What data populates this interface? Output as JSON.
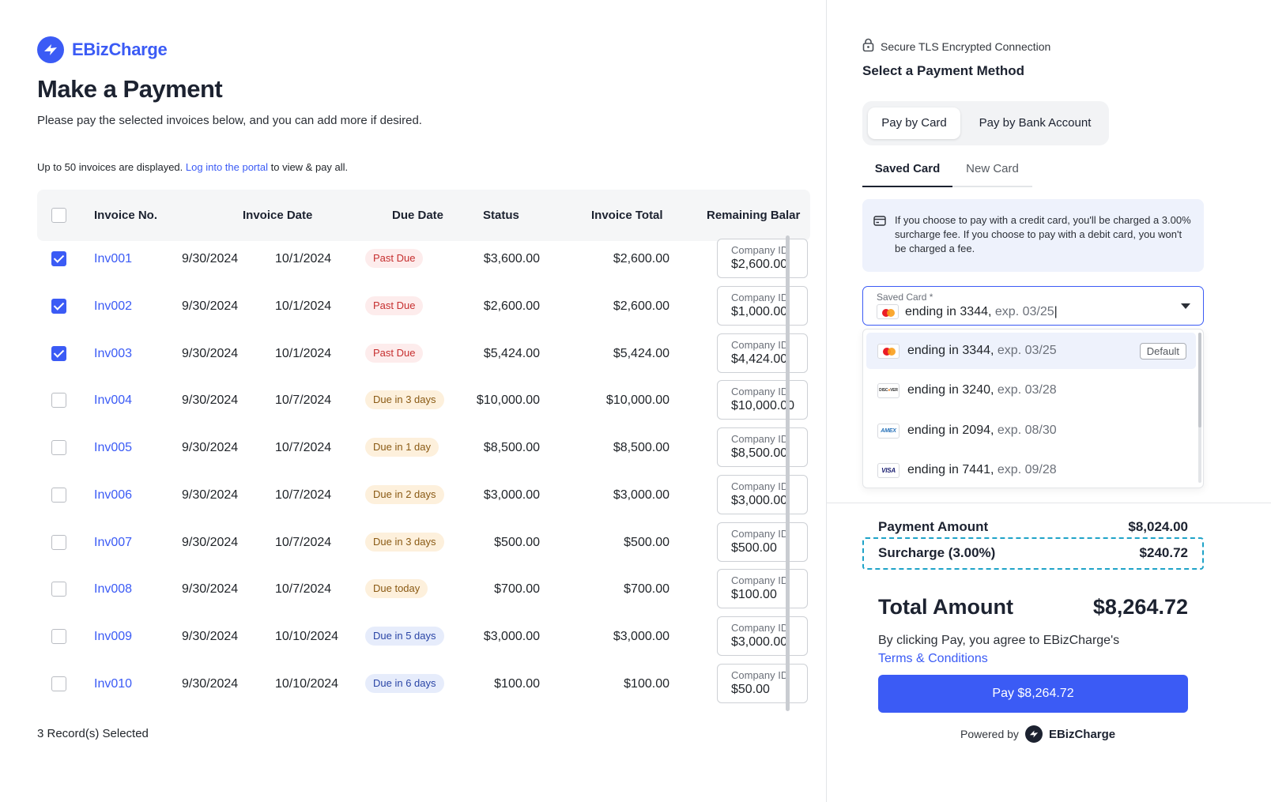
{
  "brand": {
    "name": "EBizCharge"
  },
  "header": {
    "title": "Make a Payment",
    "subtitle": "Please pay the selected invoices below, and you can add more if desired."
  },
  "notice": {
    "prefix": "Up to 50 invoices are displayed.",
    "link": "Log into the portal",
    "suffix": "to view & pay all."
  },
  "table": {
    "columns": [
      "Invoice No.",
      "Invoice Date",
      "Due Date",
      "Status",
      "Invoice Total",
      "Remaining Balar"
    ],
    "rows": [
      {
        "checked": true,
        "invoice": "Inv001",
        "invoice_date": "9/30/2024",
        "due_date": "10/1/2024",
        "status": "Past Due",
        "status_kind": "past",
        "total": "$3,600.00",
        "remaining": "$2,600.00",
        "pay_label": "Company ID",
        "pay_value": "$2,600.00"
      },
      {
        "checked": true,
        "invoice": "Inv002",
        "invoice_date": "9/30/2024",
        "due_date": "10/1/2024",
        "status": "Past Due",
        "status_kind": "past",
        "total": "$2,600.00",
        "remaining": "$2,600.00",
        "pay_label": "Company ID",
        "pay_value": "$1,000.00"
      },
      {
        "checked": true,
        "invoice": "Inv003",
        "invoice_date": "9/30/2024",
        "due_date": "10/1/2024",
        "status": "Past Due",
        "status_kind": "past",
        "total": "$5,424.00",
        "remaining": "$5,424.00",
        "pay_label": "Company ID",
        "pay_value": "$4,424.00"
      },
      {
        "checked": false,
        "invoice": "Inv004",
        "invoice_date": "9/30/2024",
        "due_date": "10/7/2024",
        "status": "Due in 3 days",
        "status_kind": "soon",
        "total": "$10,000.00",
        "remaining": "$10,000.00",
        "pay_label": "Company ID",
        "pay_value": "$10,000.00"
      },
      {
        "checked": false,
        "invoice": "Inv005",
        "invoice_date": "9/30/2024",
        "due_date": "10/7/2024",
        "status": "Due in 1 day",
        "status_kind": "soon",
        "total": "$8,500.00",
        "remaining": "$8,500.00",
        "pay_label": "Company ID",
        "pay_value": "$8,500.00"
      },
      {
        "checked": false,
        "invoice": "Inv006",
        "invoice_date": "9/30/2024",
        "due_date": "10/7/2024",
        "status": "Due in 2 days",
        "status_kind": "soon",
        "total": "$3,000.00",
        "remaining": "$3,000.00",
        "pay_label": "Company ID",
        "pay_value": "$3,000.00"
      },
      {
        "checked": false,
        "invoice": "Inv007",
        "invoice_date": "9/30/2024",
        "due_date": "10/7/2024",
        "status": "Due in 3 days",
        "status_kind": "soon",
        "total": "$500.00",
        "remaining": "$500.00",
        "pay_label": "Company ID",
        "pay_value": "$500.00"
      },
      {
        "checked": false,
        "invoice": "Inv008",
        "invoice_date": "9/30/2024",
        "due_date": "10/7/2024",
        "status": "Due today",
        "status_kind": "soon",
        "total": "$700.00",
        "remaining": "$700.00",
        "pay_label": "Company ID",
        "pay_value": "$100.00"
      },
      {
        "checked": false,
        "invoice": "Inv009",
        "invoice_date": "9/30/2024",
        "due_date": "10/10/2024",
        "status": "Due in 5 days",
        "status_kind": "later",
        "total": "$3,000.00",
        "remaining": "$3,000.00",
        "pay_label": "Company ID",
        "pay_value": "$3,000.00"
      },
      {
        "checked": false,
        "invoice": "Inv010",
        "invoice_date": "9/30/2024",
        "due_date": "10/10/2024",
        "status": "Due in 6 days",
        "status_kind": "later",
        "total": "$100.00",
        "remaining": "$100.00",
        "pay_label": "Company ID",
        "pay_value": "$50.00"
      }
    ],
    "selected_count": "3 Record(s) Selected"
  },
  "payment": {
    "secure_text": "Secure TLS Encrypted Connection",
    "title": "Select a Payment Method",
    "method_tabs": [
      "Pay by Card",
      "Pay by Bank Account"
    ],
    "card_tabs": [
      "Saved Card",
      "New Card"
    ],
    "info": "If you choose to pay with a credit card, you'll be charged a 3.00% surcharge fee. If you choose to pay with a debit card, you won't be charged a fee.",
    "saved_card": {
      "label": "Saved Card",
      "required_mark": "*",
      "value_number": "ending in 3344,",
      "value_exp": "exp. 03/25"
    },
    "options": [
      {
        "brand": "mastercard",
        "number": "ending in 3344,",
        "exp": "exp. 03/25",
        "tag": "Default"
      },
      {
        "brand": "discover",
        "number": "ending in 3240,",
        "exp": "exp. 03/28"
      },
      {
        "brand": "amex",
        "number": "ending in 2094,",
        "exp": "exp. 08/30"
      },
      {
        "brand": "visa",
        "number": "ending in 7441,",
        "exp": "exp. 09/28"
      }
    ],
    "summary": {
      "payment_amount_label": "Payment Amount",
      "payment_amount": "$8,024.00",
      "surcharge_label": "Surcharge (3.00%)",
      "surcharge": "$240.72",
      "total_label": "Total Amount",
      "total": "$8,264.72"
    },
    "agree_text": "By clicking Pay, you agree to EBizCharge's",
    "terms_link": "Terms & Conditions",
    "pay_button": "Pay $8,264.72",
    "powered_by": "Powered by",
    "powered_brand": "EBizCharge"
  },
  "colors": {
    "accent": "#3b5bf5",
    "surcharge_outline": "#1fa3c8"
  },
  "icons": [
    "ebizcharge-logo",
    "lock-icon",
    "credit-card-icon",
    "chevron-down-icon",
    "mastercard-icon",
    "discover-icon",
    "amex-icon",
    "visa-icon"
  ]
}
